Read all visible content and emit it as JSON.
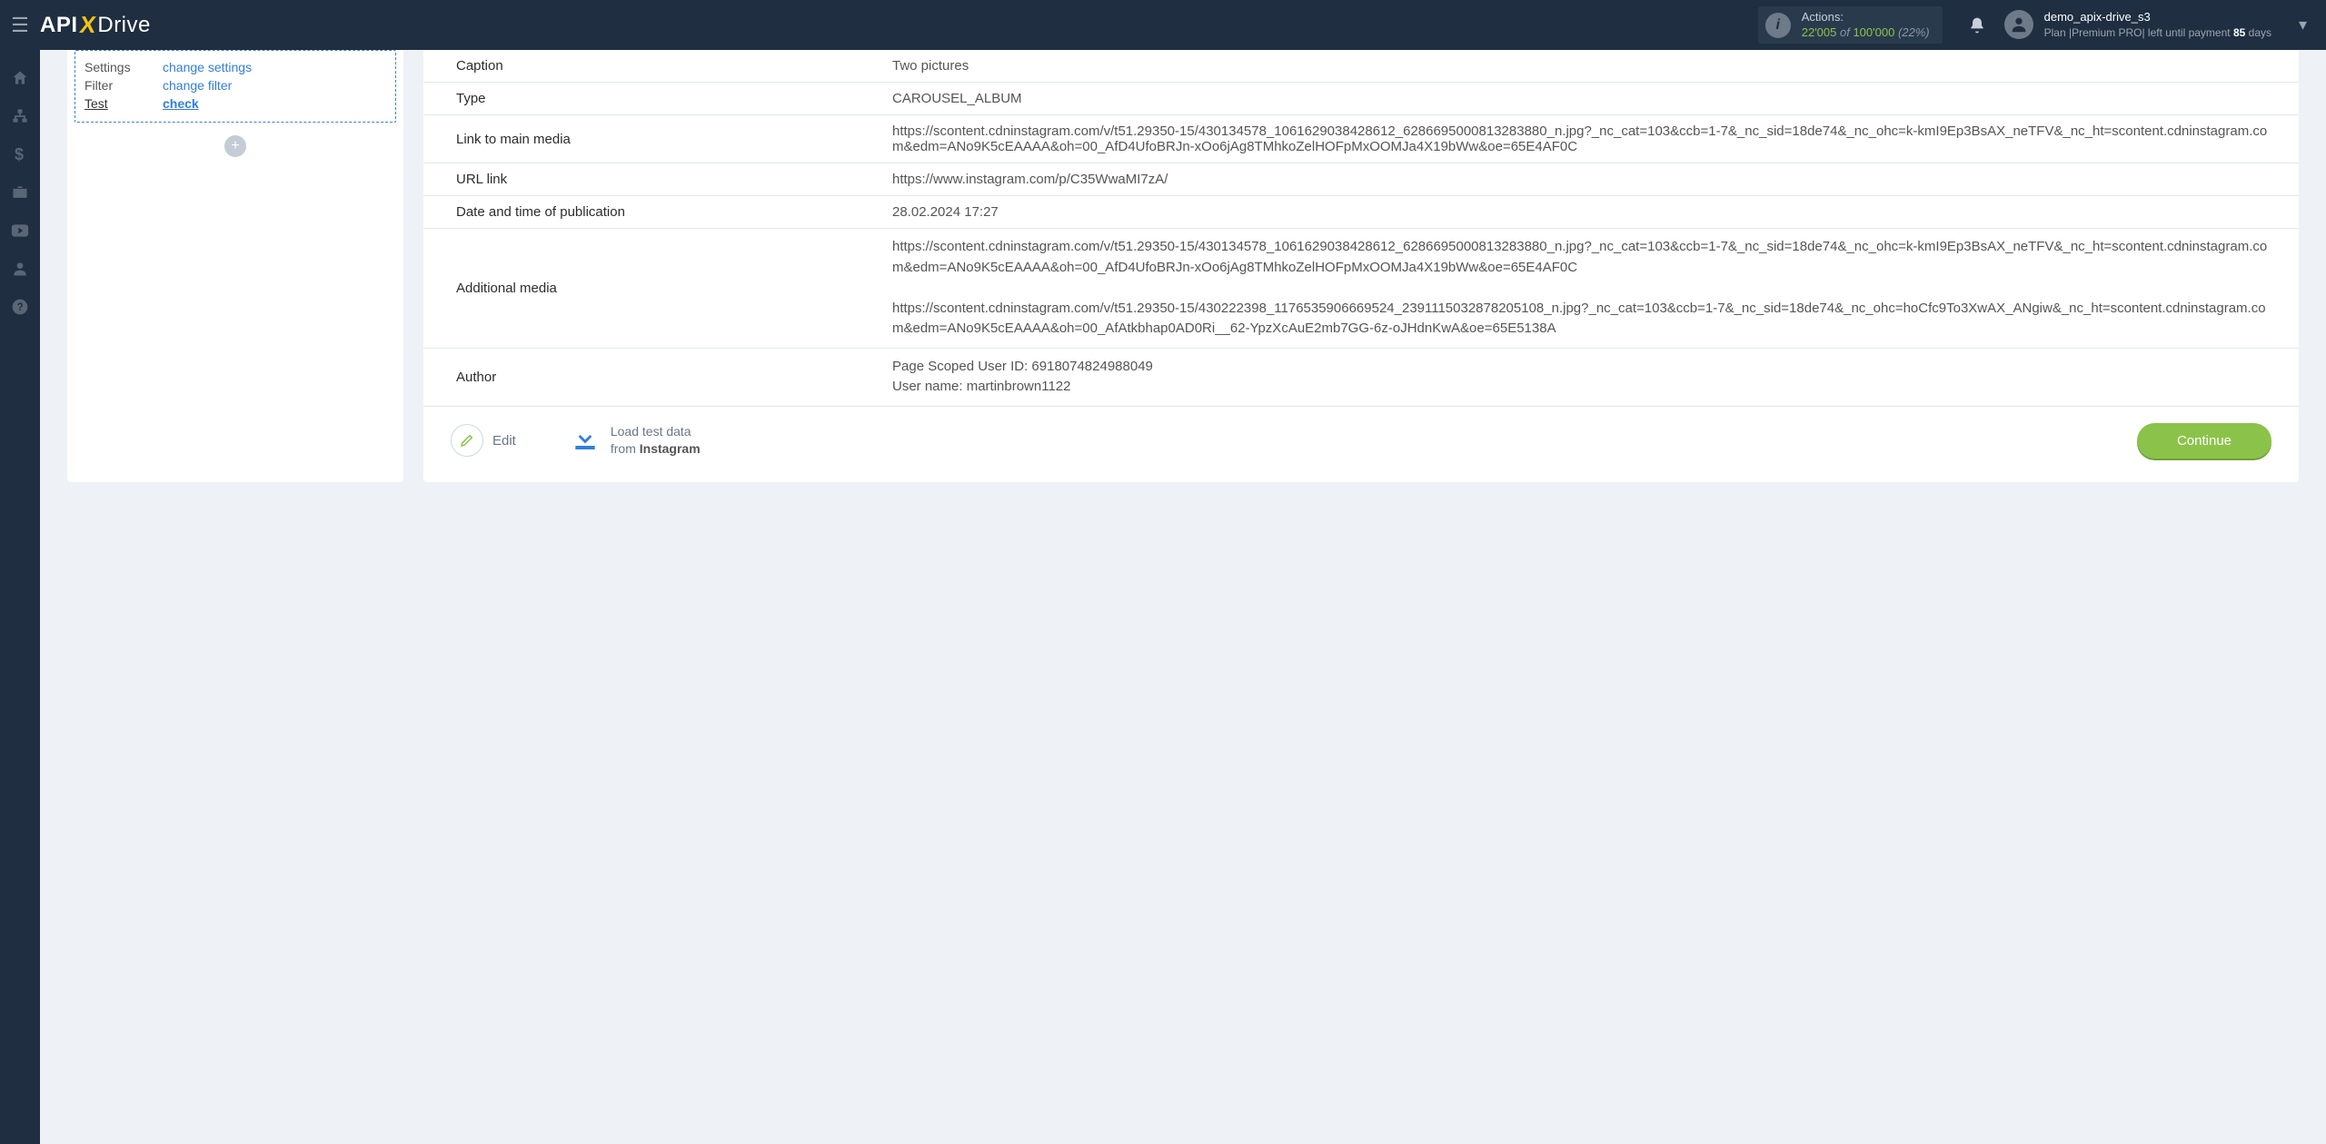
{
  "header": {
    "actions_label": "Actions:",
    "actions_used": "22'005",
    "actions_of": " of ",
    "actions_total": "100'000",
    "actions_pct": " (22%)",
    "username": "demo_apix-drive_s3",
    "plan_prefix": "Plan ",
    "plan_name": "|Premium PRO|",
    "plan_suffix": " left until payment ",
    "plan_days": "85",
    "plan_days_word": " days"
  },
  "logo": {
    "part1": "API",
    "x": "X",
    "part2": "Drive"
  },
  "step": {
    "settings_k": "Settings",
    "settings_v": "change settings",
    "filter_k": "Filter",
    "filter_v": "change filter",
    "test_k": "Test",
    "test_v": "check"
  },
  "rows": [
    {
      "k": "Caption",
      "v": "Two pictures"
    },
    {
      "k": "Type",
      "v": "CAROUSEL_ALBUM"
    },
    {
      "k": "Link to main media",
      "v": "https://scontent.cdninstagram.com/v/t51.29350-15/430134578_1061629038428612_6286695000813283880_n.jpg?_nc_cat=103&ccb=1-7&_nc_sid=18de74&_nc_ohc=k-kmI9Ep3BsAX_neTFV&_nc_ht=scontent.cdninstagram.com&edm=ANo9K5cEAAAA&oh=00_AfD4UfoBRJn-xOo6jAg8TMhkoZelHOFpMxOOMJa4X19bWw&oe=65E4AF0C"
    },
    {
      "k": "URL link",
      "v": "https://www.instagram.com/p/C35WwaMI7zA/"
    },
    {
      "k": "Date and time of publication",
      "v": "28.02.2024 17:27"
    },
    {
      "k": "Additional media",
      "v": "https://scontent.cdninstagram.com/v/t51.29350-15/430134578_1061629038428612_6286695000813283880_n.jpg?_nc_cat=103&ccb=1-7&_nc_sid=18de74&_nc_ohc=k-kmI9Ep3BsAX_neTFV&_nc_ht=scontent.cdninstagram.com&edm=ANo9K5cEAAAA&oh=00_AfD4UfoBRJn-xOo6jAg8TMhkoZelHOFpMxOOMJa4X19bWw&oe=65E4AF0C\n\nhttps://scontent.cdninstagram.com/v/t51.29350-15/430222398_1176535906669524_2391115032878205108_n.jpg?_nc_cat=103&ccb=1-7&_nc_sid=18de74&_nc_ohc=hoCfc9To3XwAX_ANgiw&_nc_ht=scontent.cdninstagram.com&edm=ANo9K5cEAAAA&oh=00_AfAtkbhap0AD0Ri__62-YpzXcAuE2mb7GG-6z-oJHdnKwA&oe=65E5138A"
    },
    {
      "k": "Author",
      "v": "Page Scoped User ID: 6918074824988049\nUser name: martinbrown1122"
    }
  ],
  "actions": {
    "edit": "Edit",
    "load_line1": "Load test data",
    "load_from": "from ",
    "load_src": "Instagram",
    "continue": "Continue"
  }
}
